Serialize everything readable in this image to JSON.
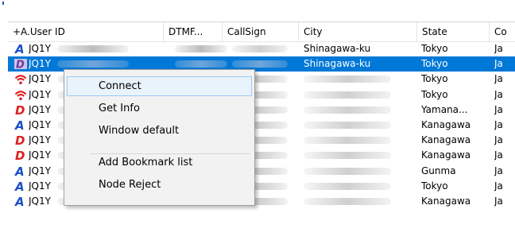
{
  "columns": [
    "+A.User ID",
    "DTMF...",
    "CallSign",
    "City",
    "State",
    "Co"
  ],
  "rows": [
    {
      "icon": "blue-a-icon",
      "id": "JQ1Y",
      "city": "Shinagawa-ku",
      "state": "Tokyo",
      "country": "Ja",
      "selected": false
    },
    {
      "icon": "purple-d-icon",
      "id": "JQ1Y",
      "city": "Shinagawa-ku",
      "state": "Tokyo",
      "country": "Ja",
      "selected": true
    },
    {
      "icon": "wifi-red-icon",
      "id": "JQ1Y",
      "city": "",
      "state": "Tokyo",
      "country": "Ja",
      "selected": false
    },
    {
      "icon": "wifi-red-icon",
      "id": "JQ1Y",
      "city": "",
      "state": "Tokyo",
      "country": "Ja",
      "selected": false
    },
    {
      "icon": "red-d-icon",
      "id": "JQ1Y",
      "city": "",
      "state": "Yamana...",
      "country": "Ja",
      "selected": false
    },
    {
      "icon": "blue-a-icon",
      "id": "JQ1Y",
      "city": "",
      "state": "Kanagawa",
      "country": "Ja",
      "selected": false
    },
    {
      "icon": "red-d-icon",
      "id": "JQ1Y",
      "city": "",
      "state": "Kanagawa",
      "country": "Ja",
      "selected": false
    },
    {
      "icon": "red-d-icon",
      "id": "JQ1Y",
      "city": "",
      "state": "Kanagawa",
      "country": "Ja",
      "selected": false
    },
    {
      "icon": "blue-a-icon",
      "id": "JQ1Y",
      "city": "",
      "state": "Gunma",
      "country": "Ja",
      "selected": false
    },
    {
      "icon": "blue-a-icon",
      "id": "JQ1Y",
      "city": "",
      "state": "Tokyo",
      "country": "Ja",
      "selected": false
    },
    {
      "icon": "blue-a-icon",
      "id": "JQ1Y",
      "city": "",
      "state": "Kanagawa",
      "country": "Ja",
      "selected": false
    }
  ],
  "context_menu": {
    "connect": "Connect",
    "get_info": "Get Info",
    "window_default": "Window default",
    "add_bookmark": "Add Bookmark list",
    "node_reject": "Node Reject"
  },
  "colors": {
    "selection": "#0078d7",
    "menu_hover": "#e9f3fc",
    "icon_blue": "#1a4fc4",
    "icon_red": "#e02020",
    "icon_purple": "#6a3a9a"
  }
}
